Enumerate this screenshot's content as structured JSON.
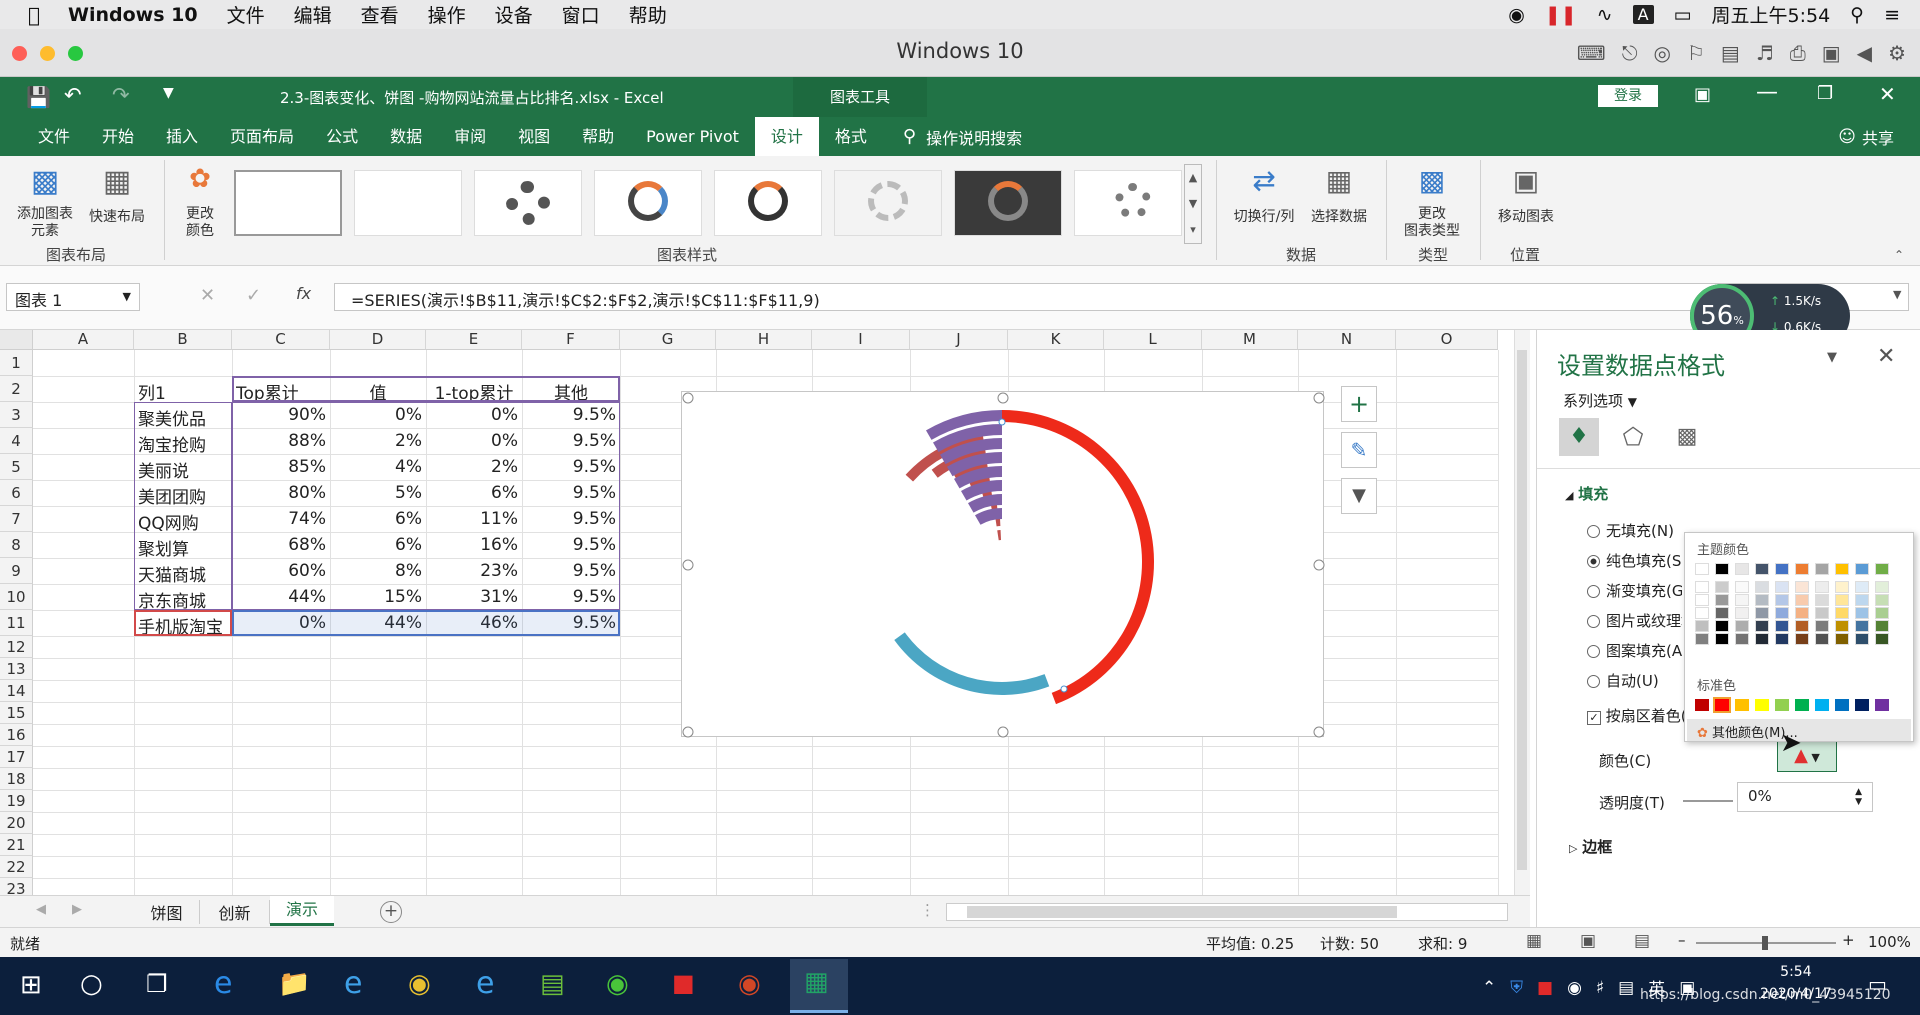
{
  "mac_menubar": {
    "app": "Windows 10",
    "menus": [
      "文件",
      "编辑",
      "查看",
      "操作",
      "设备",
      "窗口",
      "帮助"
    ],
    "clock": "周五上午5:54",
    "input": "A"
  },
  "window_title": "Windows 10",
  "excel": {
    "file_title": "2.3-图表变化、饼图 -购物网站流量占比排名.xlsx  -  Excel",
    "context_tool": "图表工具",
    "login": "登录",
    "tabs": [
      "文件",
      "开始",
      "插入",
      "页面布局",
      "公式",
      "数据",
      "审阅",
      "视图",
      "帮助",
      "Power Pivot",
      "设计",
      "格式"
    ],
    "search": "操作说明搜索",
    "share": "共享",
    "ribbon": {
      "add_element": "添加图表\n元素",
      "quick_layout": "快速布局",
      "change_color": "更改\n颜色",
      "layout_group": "图表布局",
      "styles_group": "图表样式",
      "switch_rowcol": "切换行/列",
      "select_data": "选择数据",
      "data_group": "数据",
      "change_type": "更改\n图表类型",
      "type_group": "类型",
      "move_chart": "移动图表",
      "location_group": "位置"
    },
    "name_box": "图表 1",
    "formula": "=SERIES(演示!$B$11,演示!$C$2:$F$2,演示!$C$11:$F$11,9)",
    "fx": "fx",
    "columns": [
      "A",
      "B",
      "C",
      "D",
      "E",
      "F",
      "G",
      "H",
      "I",
      "J",
      "K",
      "L",
      "M",
      "N",
      "O"
    ],
    "rows": [
      "1",
      "2",
      "3",
      "4",
      "5",
      "6",
      "7",
      "8",
      "9",
      "10",
      "11",
      "12",
      "13",
      "14",
      "15",
      "16",
      "17",
      "18",
      "19",
      "20",
      "21",
      "22",
      "23"
    ],
    "table": {
      "header": [
        "列1",
        "Top累计",
        "值",
        "1-top累计",
        "其他"
      ],
      "data": [
        [
          "聚美优品",
          "90%",
          "0%",
          "0%",
          "9.5%"
        ],
        [
          "淘宝抢购",
          "88%",
          "2%",
          "0%",
          "9.5%"
        ],
        [
          "美丽说",
          "85%",
          "4%",
          "2%",
          "9.5%"
        ],
        [
          "美团团购",
          "80%",
          "5%",
          "6%",
          "9.5%"
        ],
        [
          "QQ网购",
          "74%",
          "6%",
          "11%",
          "9.5%"
        ],
        [
          "聚划算",
          "68%",
          "6%",
          "16%",
          "9.5%"
        ],
        [
          "天猫商城",
          "60%",
          "8%",
          "23%",
          "9.5%"
        ],
        [
          "京东商城",
          "44%",
          "15%",
          "31%",
          "9.5%"
        ],
        [
          "手机版淘宝",
          "0%",
          "44%",
          "46%",
          "9.5%"
        ]
      ]
    },
    "sheets": [
      "饼图",
      "创新",
      "演示"
    ],
    "active_sheet": "演示",
    "status": {
      "ready": "就绪",
      "avg": "平均值: 0.25",
      "count": "计数: 50",
      "sum": "求和: 9",
      "zoom": "100%"
    }
  },
  "net_widget": {
    "percent": "56",
    "pct_sign": "%",
    "up": "1.5K/s",
    "down": "0.6K/s"
  },
  "pane": {
    "title": "设置数据点格式",
    "series_options": "系列选项",
    "fill_section": "填充",
    "options": [
      "无填充(N)",
      "纯色填充(S)",
      "渐变填充(G)",
      "图片或纹理填充(P)",
      "图案填充(A)",
      "自动(U)"
    ],
    "vary_colors": "按扇区着色(V)",
    "color_label": "颜色(C)",
    "transparency_label": "透明度(T)",
    "transparency_value": "0%",
    "border_section": "边框"
  },
  "color_popup": {
    "theme_label": "主题颜色",
    "standard_label": "标准色",
    "more": "其他颜色(M)...",
    "theme_row": [
      "#ffffff",
      "#000000",
      "#e7e6e6",
      "#44546a",
      "#4472c4",
      "#ed7d31",
      "#a5a5a5",
      "#ffc000",
      "#5b9bd5",
      "#70ad47"
    ],
    "standard_row": [
      "#c00000",
      "#ff0000",
      "#ffc000",
      "#ffff00",
      "#92d050",
      "#00b050",
      "#00b0f0",
      "#0070c0",
      "#002060",
      "#7030a0"
    ]
  },
  "taskbar": {
    "time": "5:54",
    "date": "2020/4/17",
    "ime": "英",
    "watermark": "https://blog.csdn.net/m0_43945120"
  },
  "chart_data": {
    "type": "pie",
    "description_series": "doughnut / radar composite",
    "series": [
      {
        "name": "手机版淘宝",
        "values": [
          0,
          44,
          46,
          9.5
        ]
      },
      {
        "name": "京东商城",
        "values": [
          44,
          15,
          31,
          9.5
        ]
      },
      {
        "name": "天猫商城",
        "values": [
          60,
          8,
          23,
          9.5
        ]
      },
      {
        "name": "聚划算",
        "values": [
          68,
          6,
          16,
          9.5
        ]
      },
      {
        "name": "QQ网购",
        "values": [
          74,
          6,
          11,
          9.5
        ]
      },
      {
        "name": "美团团购",
        "values": [
          80,
          5,
          6,
          9.5
        ]
      },
      {
        "name": "美丽说",
        "values": [
          85,
          4,
          2,
          9.5
        ]
      },
      {
        "name": "淘宝抢购",
        "values": [
          88,
          2,
          0,
          9.5
        ]
      },
      {
        "name": "聚美优品",
        "values": [
          90,
          0,
          0,
          9.5
        ]
      }
    ],
    "categories": [
      "Top累计",
      "值",
      "1-top累计",
      "其他"
    ],
    "colors": {
      "red": "#ee2a1a",
      "blue": "#4ba6c4",
      "rust": "#c0504d",
      "purple": "#7f62a8"
    }
  }
}
